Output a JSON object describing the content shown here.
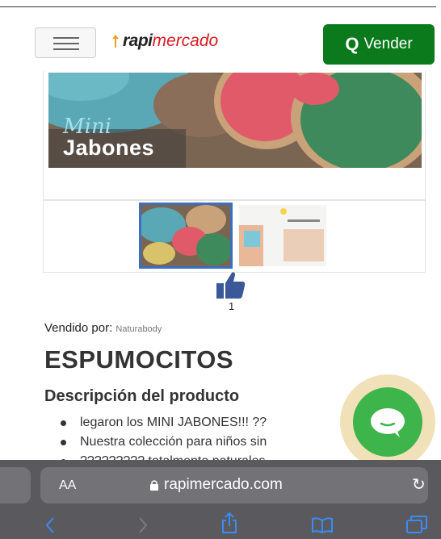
{
  "header": {
    "logo_part1": "rapi",
    "logo_part2": "mercado",
    "vender_icon": "Q",
    "vender_label": "Vender"
  },
  "hero": {
    "text_mini": "Mini",
    "text_jabones": "Jabones"
  },
  "likes": {
    "icon": "thumbs-up-icon",
    "count": "1"
  },
  "product": {
    "sold_by_label": "Vendido por:",
    "seller": "Naturabody",
    "title": "ESPUMOCITOS",
    "description_heading": "Descripción del producto",
    "bullets": [
      "legaron los MINI JABONES!!! ??",
      "Nuestra colección para niños sin",
      "????????? totalmente naturales"
    ]
  },
  "browser": {
    "aa_label": "AA",
    "url": "rapimercado.com"
  },
  "colors": {
    "vender_bg": "#0a7a1c",
    "chat_green": "#3db54a",
    "brand_red": "#d71a21",
    "nav_blue": "#3a8cf5"
  }
}
